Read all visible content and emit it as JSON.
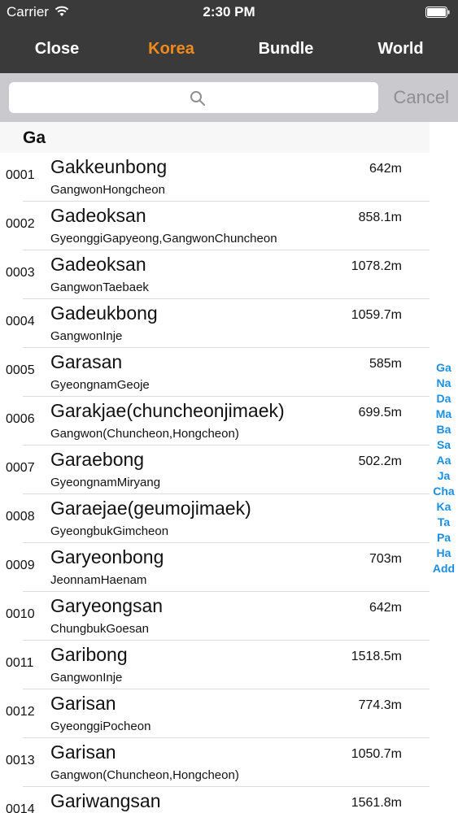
{
  "status": {
    "carrier": "Carrier",
    "time": "2:30 PM"
  },
  "nav": {
    "close": "Close",
    "korea": "Korea",
    "bundle": "Bundle",
    "world": "World"
  },
  "search": {
    "placeholder": "",
    "cancel": "Cancel"
  },
  "section": {
    "title": "Ga"
  },
  "rows": [
    {
      "num": "0001",
      "name": "Gakkeunbong",
      "region": "GangwonHongcheon",
      "height": "642m"
    },
    {
      "num": "0002",
      "name": "Gadeoksan",
      "region": "GyeonggiGapyeong,GangwonChuncheon",
      "height": "858.1m"
    },
    {
      "num": "0003",
      "name": "Gadeoksan",
      "region": "GangwonTaebaek",
      "height": "1078.2m"
    },
    {
      "num": "0004",
      "name": "Gadeukbong",
      "region": "GangwonInje",
      "height": "1059.7m"
    },
    {
      "num": "0005",
      "name": "Garasan",
      "region": "GyeongnamGeoje",
      "height": "585m"
    },
    {
      "num": "0006",
      "name": "Garakjae(chuncheonjimaek)",
      "region": "Gangwon(Chuncheon,Hongcheon)",
      "height": "699.5m"
    },
    {
      "num": "0007",
      "name": "Garaebong",
      "region": "GyeongnamMiryang",
      "height": "502.2m"
    },
    {
      "num": "0008",
      "name": "Garaejae(geumojimaek)",
      "region": "GyeongbukGimcheon",
      "height": ""
    },
    {
      "num": "0009",
      "name": "Garyeonbong",
      "region": "JeonnamHaenam",
      "height": "703m"
    },
    {
      "num": "0010",
      "name": "Garyeongsan",
      "region": "ChungbukGoesan",
      "height": "642m"
    },
    {
      "num": "0011",
      "name": "Garibong",
      "region": "GangwonInje",
      "height": "1518.5m"
    },
    {
      "num": "0012",
      "name": "Garisan",
      "region": "GyeonggiPocheon",
      "height": "774.3m"
    },
    {
      "num": "0013",
      "name": "Garisan",
      "region": "Gangwon(Chuncheon,Hongcheon)",
      "height": "1050.7m"
    },
    {
      "num": "0014",
      "name": "Gariwangsan",
      "region": "",
      "height": "1561.8m"
    }
  ],
  "index": [
    "Ga",
    "Na",
    "Da",
    "Ma",
    "Ba",
    "Sa",
    "Aa",
    "Ja",
    "Cha",
    "Ka",
    "Ta",
    "Pa",
    "Ha",
    "Add"
  ]
}
